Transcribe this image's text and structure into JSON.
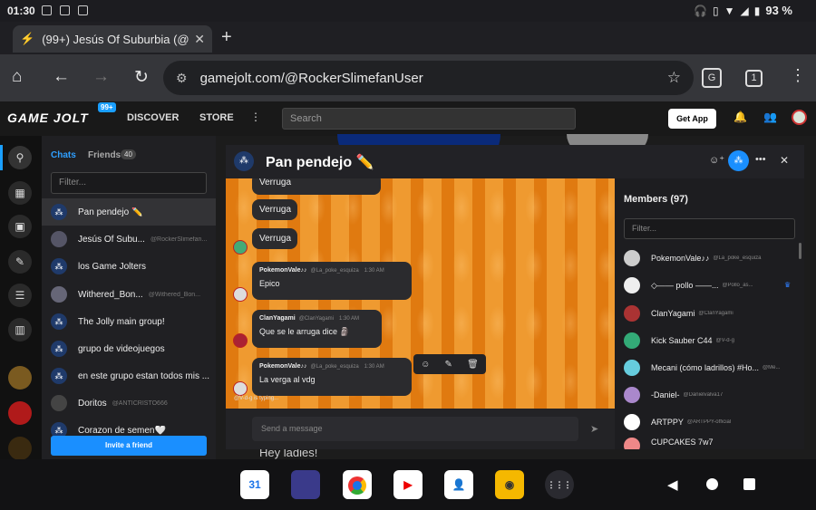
{
  "status_bar": {
    "time": "01:30",
    "battery": "93 %"
  },
  "browser": {
    "tab_title": "(99+) Jesús Of Suburbia (@",
    "tab_close": "✕",
    "new_tab": "+",
    "url": "gamejolt.com/@RockerSlimefanUser",
    "tab_count": "1"
  },
  "gamejolt": {
    "logo": "GAME JOLT",
    "notif_badge": "99+",
    "discover": "DISCOVER",
    "store": "STORE",
    "search_placeholder": "Search",
    "get_app": "Get App"
  },
  "chats_sidebar": {
    "tab_chats": "Chats",
    "tab_friends": "Friends",
    "friends_count": "40",
    "filter_placeholder": "Filter...",
    "items": [
      {
        "name": "Pan pendejo ✏️",
        "handle": ""
      },
      {
        "name": "Jesús Of Subu...",
        "handle": "@RockerSlimefan..."
      },
      {
        "name": "los Game Jolters",
        "handle": ""
      },
      {
        "name": "Withered_Bon...",
        "handle": "@Withered_Bon..."
      },
      {
        "name": "The Jolly main group!",
        "handle": ""
      },
      {
        "name": "grupo de videojuegos",
        "handle": ""
      },
      {
        "name": "en este grupo estan todos mis ...",
        "handle": ""
      },
      {
        "name": "Doritos",
        "handle": "@ANTICRISTO666"
      },
      {
        "name": "Corazon de semen🤍",
        "handle": ""
      }
    ],
    "invite_button": "Invite a friend"
  },
  "background_page": {
    "greeting": "Hey ladies!"
  },
  "chat": {
    "title": "Pan pendejo ✏️",
    "messages": [
      {
        "text": "Verruga"
      },
      {
        "text": "Verruga"
      },
      {
        "text": "Verruga"
      },
      {
        "author": "PokemonVale♪♪",
        "handle": "@La_poke_esquiza",
        "time": "1:30 AM",
        "text": "Epico"
      },
      {
        "author": "ClanYagami",
        "handle": "@ClanYagami",
        "time": "1:30 AM",
        "text": "Que se le arruga dice 🗿"
      },
      {
        "author": "PokemonVale♪♪",
        "handle": "@La_poke_esquiza",
        "time": "1:30 AM",
        "text": "La verga al vdg"
      }
    ],
    "typing": "@V-d-g is typing...",
    "send_placeholder": "Send a message"
  },
  "members": {
    "title": "Members (97)",
    "filter_placeholder": "Filter...",
    "list": [
      {
        "name": "PokemonVale♪♪",
        "handle": "@La_poke_esquiza"
      },
      {
        "name": "◇—— pollo ——...",
        "handle": "@Pollo_as..."
      },
      {
        "name": "ClanYagami",
        "handle": "@ClanYagami"
      },
      {
        "name": "Kick Sauber C44",
        "handle": "@V-d-g"
      },
      {
        "name": "Mecani (cómo ladrillos) #Ho...",
        "handle": "@Me..."
      },
      {
        "name": "-Daniel-",
        "handle": "@Danielvalva17"
      },
      {
        "name": "ARTPPY",
        "handle": "@ARTPPY-official"
      },
      {
        "name": "CUPCAKES 7w7",
        "handle": ""
      }
    ]
  },
  "dock": {
    "apps": [
      {
        "name": "calendar",
        "label": "31",
        "color": "#ffffff"
      },
      {
        "name": "game",
        "label": "",
        "color": "#3a3a8a"
      },
      {
        "name": "chrome",
        "label": "",
        "color": "#ffffff"
      },
      {
        "name": "youtube",
        "label": "▶",
        "color": "#ffffff"
      },
      {
        "name": "contacts",
        "label": "",
        "color": "#ffffff"
      },
      {
        "name": "sound",
        "label": "",
        "color": "#f5b800"
      },
      {
        "name": "apps",
        "label": "⋮⋮⋮",
        "color": "#2a2a30"
      }
    ]
  }
}
